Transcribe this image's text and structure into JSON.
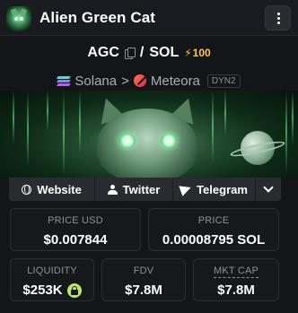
{
  "header": {
    "token_name": "Alien Green Cat",
    "menu_icon": "kebab-menu-icon"
  },
  "pair": {
    "base": "AGC",
    "separator": "/",
    "quote": "SOL",
    "boost_count": "100",
    "boost_color": "#ffc83d"
  },
  "chain": {
    "name": "Solana",
    "arrow": ">",
    "dex": "Meteora",
    "dex_variant": "DYN2"
  },
  "links": {
    "website": "Website",
    "twitter": "Twitter",
    "telegram": "Telegram"
  },
  "stats": {
    "price_usd": {
      "label": "PRICE USD",
      "value": "$0.007844"
    },
    "price_native": {
      "label": "PRICE",
      "value": "0.00008795 SOL"
    },
    "liquidity": {
      "label": "LIQUIDITY",
      "value": "$253K",
      "lock_color": "#b7e86a"
    },
    "fdv": {
      "label": "FDV",
      "value": "$7.8M"
    },
    "market_cap": {
      "label": "MKT CAP",
      "value": "$7.8M"
    }
  }
}
